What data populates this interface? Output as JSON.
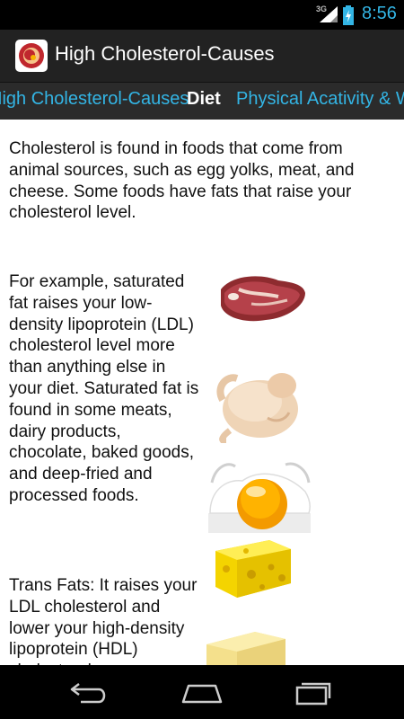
{
  "status_bar": {
    "network": "3G",
    "time": "8:56",
    "accent_color": "#33b5e5"
  },
  "action_bar": {
    "title": "High Cholesterol-Causes",
    "icon": "app-logo-icon"
  },
  "tabs": [
    {
      "label": "High Cholesterol-Causes",
      "active": false
    },
    {
      "label": "Diet",
      "active": true
    },
    {
      "label": "Physical Acativity & Weight",
      "active": false
    }
  ],
  "content": {
    "paragraph_1": "Cholesterol is found in foods that come from animal sources, such as egg yolks, meat, and cheese. Some foods have fats that raise your cholesterol level.",
    "paragraph_2": "For example, saturated fat raises your low-density lipoprotein (LDL) cholesterol level more than anything else in your diet. Saturated fat is found in some meats, dairy products, chocolate, baked goods, and deep-fried and processed foods.",
    "paragraph_3": "Trans Fats: It raises your LDL cholesterol and lower your high-density lipoprotein (HDL) cholesterol.",
    "images": [
      "steak-image",
      "chicken-image",
      "fried-egg-image",
      "cheese-image",
      "butter-image"
    ]
  },
  "nav_bar": {
    "buttons": [
      "back-icon",
      "home-icon",
      "recent-apps-icon"
    ]
  }
}
